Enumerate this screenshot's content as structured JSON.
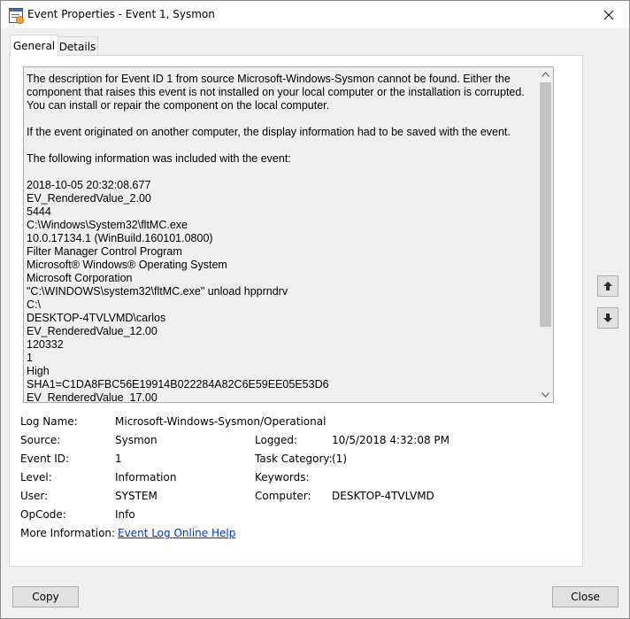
{
  "window": {
    "title": "Event Properties - Event 1, Sysmon"
  },
  "tabs": [
    {
      "label": "General",
      "active": true
    },
    {
      "label": "Details",
      "active": false
    }
  ],
  "description": {
    "paragraphs": [
      "The description for Event ID 1 from source Microsoft-Windows-Sysmon cannot be found. Either the component that raises this event is not installed on your local computer or the installation is corrupted. You can install or repair the component on the local computer.",
      "If the event originated on another computer, the display information had to be saved with the event.",
      "The following information was included with the event:"
    ],
    "lines": [
      "2018-10-05 20:32:08.677",
      "EV_RenderedValue_2.00",
      "5444",
      "C:\\Windows\\System32\\fltMC.exe",
      "10.0.17134.1 (WinBuild.160101.0800)",
      "Filter Manager Control Program",
      "Microsoft® Windows® Operating System",
      "Microsoft Corporation",
      "\"C:\\WINDOWS\\system32\\fltMC.exe\" unload hpprndrv",
      "C:\\",
      "DESKTOP-4TVLVMD\\carlos",
      "EV_RenderedValue_12.00",
      "120332",
      "1",
      "High",
      "SHA1=C1DA8FBC56E19914B022284A82C6E59EE05E53D6",
      "EV_RenderedValue_17.00"
    ]
  },
  "fields": {
    "log_name": {
      "label": "Log Name:",
      "value": "Microsoft-Windows-Sysmon/Operational"
    },
    "source": {
      "label": "Source:",
      "value": "Sysmon"
    },
    "logged": {
      "label": "Logged:",
      "value": "10/5/2018 4:32:08 PM"
    },
    "event_id": {
      "label": "Event ID:",
      "value": "1"
    },
    "task_category": {
      "label": "Task Category:",
      "value": "(1)"
    },
    "level": {
      "label": "Level:",
      "value": "Information"
    },
    "keywords": {
      "label": "Keywords:",
      "value": ""
    },
    "user": {
      "label": "User:",
      "value": "SYSTEM"
    },
    "computer": {
      "label": "Computer:",
      "value": "DESKTOP-4TVLVMD"
    },
    "opcode": {
      "label": "OpCode:",
      "value": "Info"
    },
    "more_info": {
      "label": "More Information:",
      "link": "Event Log Online Help"
    }
  },
  "nav_buttons": {
    "up_icon": "arrow-up-icon",
    "down_icon": "arrow-down-icon"
  },
  "buttons": {
    "copy": "Copy",
    "close": "Close"
  }
}
